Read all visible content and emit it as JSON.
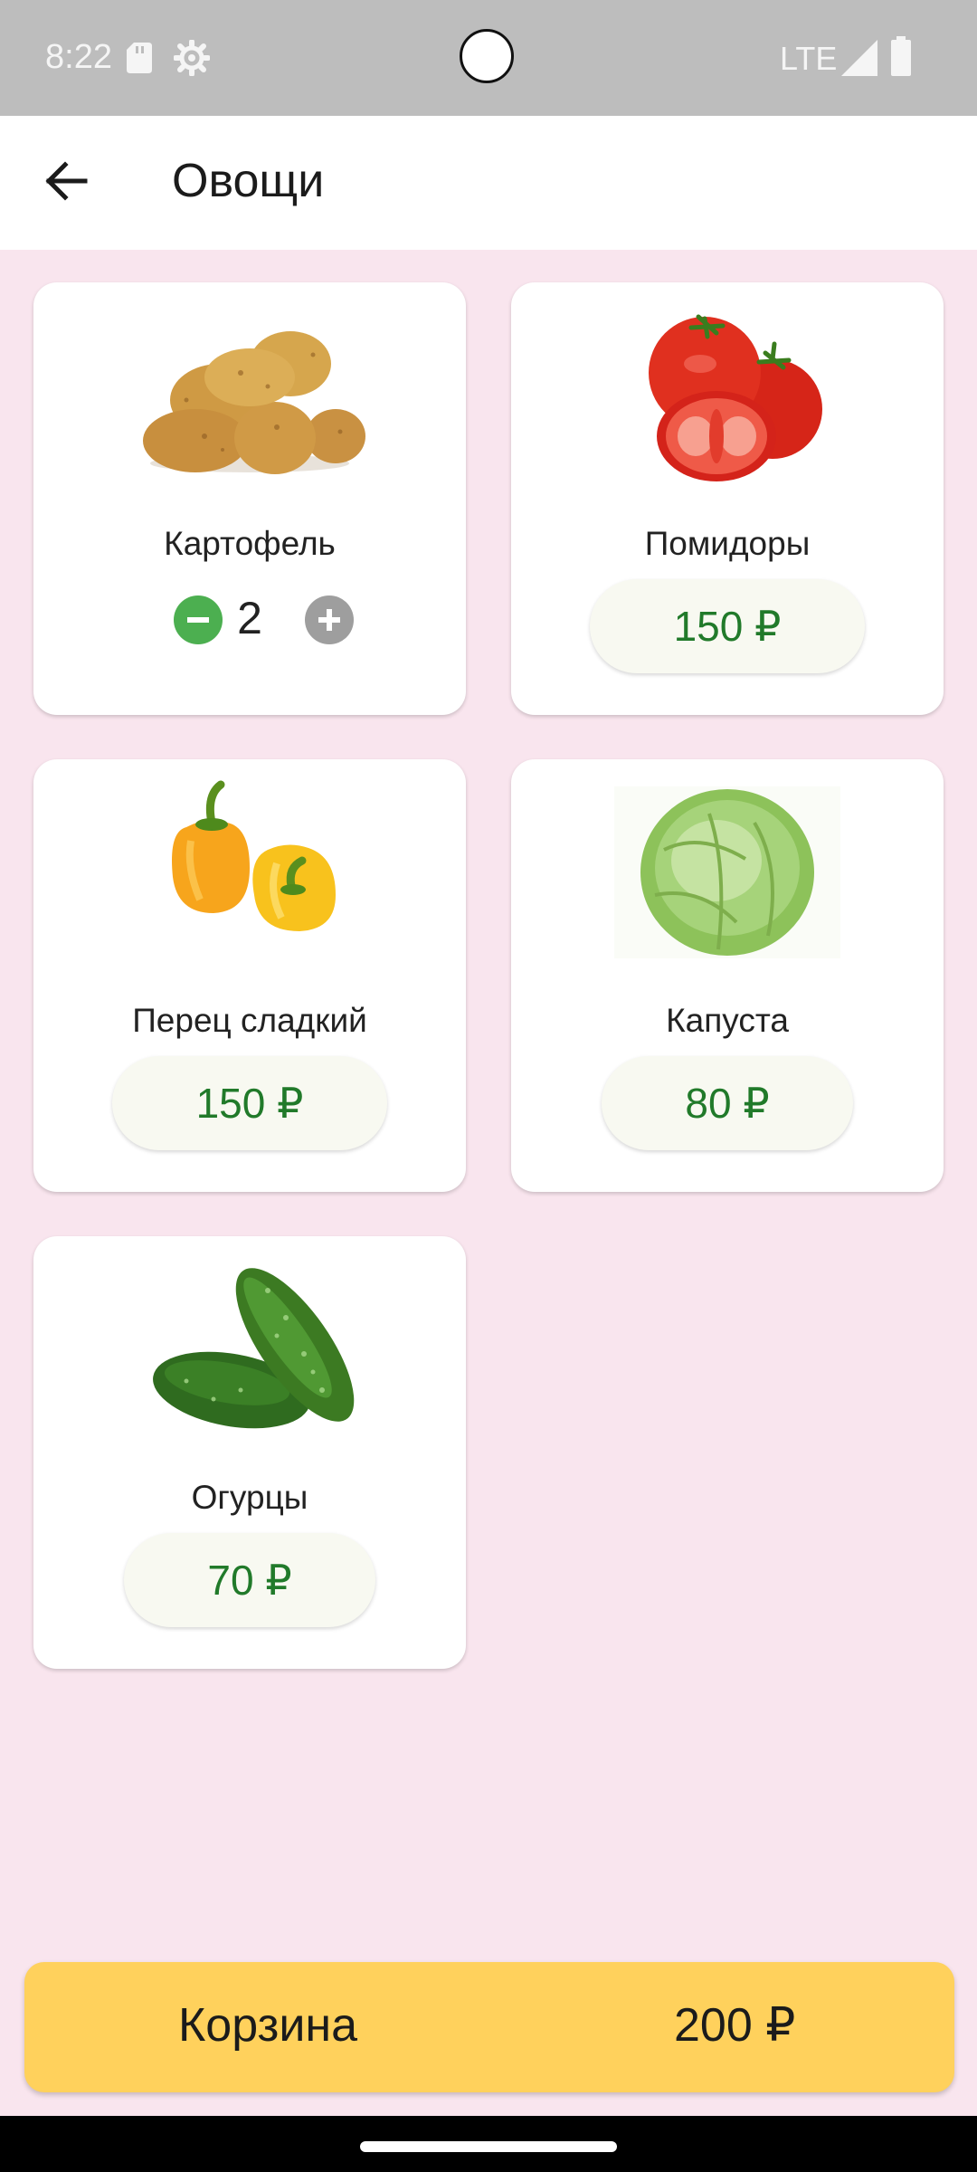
{
  "status_bar": {
    "time": "8:22",
    "network": "LTE",
    "icons": [
      "sd-card-icon",
      "gear-icon",
      "camera-cutout",
      "signal-icon",
      "battery-icon"
    ]
  },
  "header": {
    "title": "Овощи",
    "back_icon": "arrow-back-icon"
  },
  "products": [
    {
      "name": "Картофель",
      "quantity": "2",
      "in_cart": true,
      "image": "potato-image"
    },
    {
      "name": "Помидоры",
      "price": "150 ₽",
      "image": "tomato-image"
    },
    {
      "name": "Перец сладкий",
      "price": "150 ₽",
      "image": "pepper-image"
    },
    {
      "name": "Капуста",
      "price": "80 ₽",
      "image": "cabbage-image"
    },
    {
      "name": "Огурцы",
      "price": "70 ₽",
      "image": "cucumber-image"
    }
  ],
  "cart": {
    "label": "Корзина",
    "total": "200 ₽"
  },
  "colors": {
    "background": "#f9e5ee",
    "price_text": "#217a2a",
    "cart_button": "#ffd15c",
    "minus_button": "#4caf50",
    "plus_button": "#9e9e9e"
  }
}
